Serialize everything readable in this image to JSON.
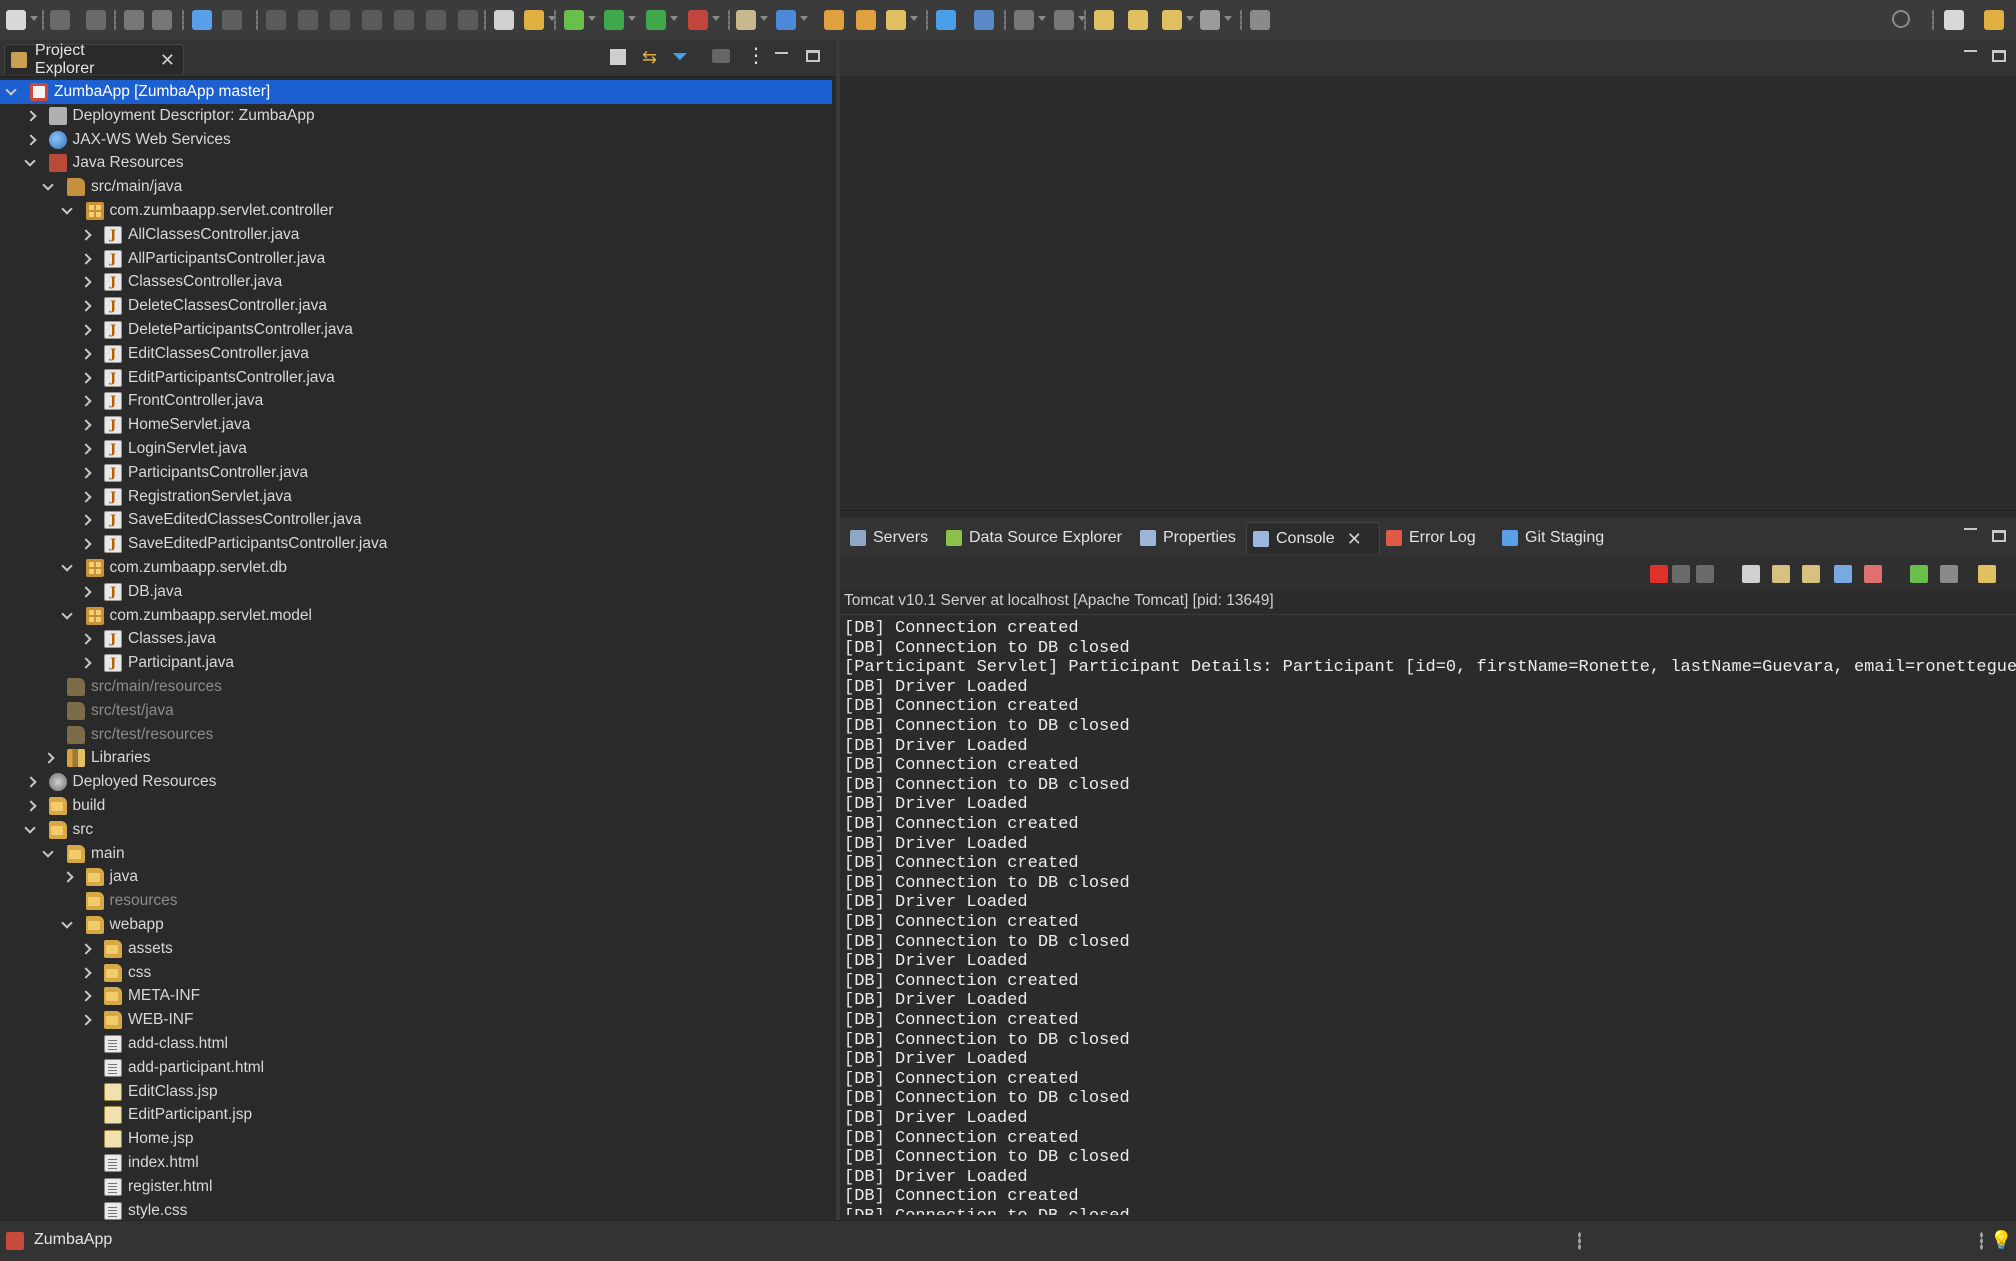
{
  "explorer": {
    "tab_label": "Project Explorer",
    "tree": [
      {
        "label": "ZumbaApp [ZumbaApp master]",
        "level": 0,
        "twisty": "open",
        "icon": "project-icon",
        "selected": true
      },
      {
        "label": "Deployment Descriptor: ZumbaApp",
        "level": 1,
        "twisty": "closed",
        "icon": "deployment-descriptor-icon"
      },
      {
        "label": "JAX-WS Web Services",
        "level": 1,
        "twisty": "closed",
        "icon": "web-services-icon"
      },
      {
        "label": "Java Resources",
        "level": 1,
        "twisty": "open",
        "icon": "java-resources-icon"
      },
      {
        "label": "src/main/java",
        "level": 2,
        "twisty": "open",
        "icon": "source-folder-icon"
      },
      {
        "label": "com.zumbaapp.servlet.controller",
        "level": 3,
        "twisty": "open",
        "icon": "package-icon"
      },
      {
        "label": "AllClassesController.java",
        "level": 4,
        "twisty": "closed",
        "icon": "java-file-icon"
      },
      {
        "label": "AllParticipantsController.java",
        "level": 4,
        "twisty": "closed",
        "icon": "java-file-icon"
      },
      {
        "label": "ClassesController.java",
        "level": 4,
        "twisty": "closed",
        "icon": "java-file-icon"
      },
      {
        "label": "DeleteClassesController.java",
        "level": 4,
        "twisty": "closed",
        "icon": "java-file-icon"
      },
      {
        "label": "DeleteParticipantsController.java",
        "level": 4,
        "twisty": "closed",
        "icon": "java-file-icon"
      },
      {
        "label": "EditClassesController.java",
        "level": 4,
        "twisty": "closed",
        "icon": "java-file-icon"
      },
      {
        "label": "EditParticipantsController.java",
        "level": 4,
        "twisty": "closed",
        "icon": "java-file-icon"
      },
      {
        "label": "FrontController.java",
        "level": 4,
        "twisty": "closed",
        "icon": "java-file-icon"
      },
      {
        "label": "HomeServlet.java",
        "level": 4,
        "twisty": "closed",
        "icon": "java-file-icon"
      },
      {
        "label": "LoginServlet.java",
        "level": 4,
        "twisty": "closed",
        "icon": "java-file-icon"
      },
      {
        "label": "ParticipantsController.java",
        "level": 4,
        "twisty": "closed",
        "icon": "java-file-icon"
      },
      {
        "label": "RegistrationServlet.java",
        "level": 4,
        "twisty": "closed",
        "icon": "java-file-icon"
      },
      {
        "label": "SaveEditedClassesController.java",
        "level": 4,
        "twisty": "closed",
        "icon": "java-file-icon"
      },
      {
        "label": "SaveEditedParticipantsController.java",
        "level": 4,
        "twisty": "closed",
        "icon": "java-file-icon"
      },
      {
        "label": "com.zumbaapp.servlet.db",
        "level": 3,
        "twisty": "open",
        "icon": "package-icon"
      },
      {
        "label": "DB.java",
        "level": 4,
        "twisty": "closed",
        "icon": "java-file-icon"
      },
      {
        "label": "com.zumbaapp.servlet.model",
        "level": 3,
        "twisty": "open",
        "icon": "package-icon"
      },
      {
        "label": "Classes.java",
        "level": 4,
        "twisty": "closed",
        "icon": "java-file-icon"
      },
      {
        "label": "Participant.java",
        "level": 4,
        "twisty": "closed",
        "icon": "java-file-icon"
      },
      {
        "label": "src/main/resources",
        "level": 2,
        "twisty": "none",
        "icon": "source-folder-icon",
        "dim": true
      },
      {
        "label": "src/test/java",
        "level": 2,
        "twisty": "none",
        "icon": "source-folder-icon",
        "dim": true
      },
      {
        "label": "src/test/resources",
        "level": 2,
        "twisty": "none",
        "icon": "source-folder-icon",
        "dim": true
      },
      {
        "label": "Libraries",
        "level": 2,
        "twisty": "closed",
        "icon": "libraries-icon"
      },
      {
        "label": "Deployed Resources",
        "level": 1,
        "twisty": "closed",
        "icon": "deployed-resources-icon"
      },
      {
        "label": "build",
        "level": 1,
        "twisty": "closed",
        "icon": "folder-icon"
      },
      {
        "label": "src",
        "level": 1,
        "twisty": "open",
        "icon": "folder-icon"
      },
      {
        "label": "main",
        "level": 2,
        "twisty": "open",
        "icon": "folder-icon"
      },
      {
        "label": "java",
        "level": 3,
        "twisty": "closed",
        "icon": "folder-icon"
      },
      {
        "label": "resources",
        "level": 3,
        "twisty": "none",
        "icon": "folder-icon",
        "dim": true
      },
      {
        "label": "webapp",
        "level": 3,
        "twisty": "open",
        "icon": "folder-icon"
      },
      {
        "label": "assets",
        "level": 4,
        "twisty": "closed",
        "icon": "folder-icon"
      },
      {
        "label": "css",
        "level": 4,
        "twisty": "closed",
        "icon": "folder-icon"
      },
      {
        "label": "META-INF",
        "level": 4,
        "twisty": "closed",
        "icon": "folder-icon"
      },
      {
        "label": "WEB-INF",
        "level": 4,
        "twisty": "closed",
        "icon": "folder-icon"
      },
      {
        "label": "add-class.html",
        "level": 4,
        "twisty": "none",
        "icon": "html-file-icon"
      },
      {
        "label": "add-participant.html",
        "level": 4,
        "twisty": "none",
        "icon": "html-file-icon"
      },
      {
        "label": "EditClass.jsp",
        "level": 4,
        "twisty": "none",
        "icon": "jsp-file-icon"
      },
      {
        "label": "EditParticipant.jsp",
        "level": 4,
        "twisty": "none",
        "icon": "jsp-file-icon"
      },
      {
        "label": "Home.jsp",
        "level": 4,
        "twisty": "none",
        "icon": "jsp-file-icon"
      },
      {
        "label": "index.html",
        "level": 4,
        "twisty": "none",
        "icon": "html-file-icon"
      },
      {
        "label": "register.html",
        "level": 4,
        "twisty": "none",
        "icon": "html-file-icon"
      },
      {
        "label": "style.css",
        "level": 4,
        "twisty": "none",
        "icon": "css-file-icon"
      }
    ]
  },
  "console": {
    "tabs": [
      {
        "label": "Servers",
        "icon": "servers-icon"
      },
      {
        "label": "Data Source Explorer",
        "icon": "data-source-icon"
      },
      {
        "label": "Properties",
        "icon": "properties-icon"
      },
      {
        "label": "Console",
        "icon": "console-icon",
        "active": true
      },
      {
        "label": "Error Log",
        "icon": "error-log-icon"
      },
      {
        "label": "Git Staging",
        "icon": "git-staging-icon"
      }
    ],
    "description": "Tomcat v10.1 Server at localhost [Apache Tomcat]  [pid: 13649]",
    "lines": [
      "[DB] Connection created",
      "[DB] Connection to DB closed",
      "[Participant Servlet] Participant Details: Participant [id=0, firstName=Ronette, lastName=Guevara, email=ronetteguevara",
      "[DB] Driver Loaded",
      "[DB] Connection created",
      "[DB] Connection to DB closed",
      "[DB] Driver Loaded",
      "[DB] Connection created",
      "[DB] Connection to DB closed",
      "[DB] Driver Loaded",
      "[DB] Connection created",
      "[DB] Driver Loaded",
      "[DB] Connection created",
      "[DB] Connection to DB closed",
      "[DB] Driver Loaded",
      "[DB] Connection created",
      "[DB] Connection to DB closed",
      "[DB] Driver Loaded",
      "[DB] Connection created",
      "[DB] Driver Loaded",
      "[DB] Connection created",
      "[DB] Connection to DB closed",
      "[DB] Driver Loaded",
      "[DB] Connection created",
      "[DB] Connection to DB closed",
      "[DB] Driver Loaded",
      "[DB] Connection created",
      "[DB] Connection to DB closed",
      "[DB] Driver Loaded",
      "[DB] Connection created",
      "[DB] Connection to DB closed"
    ]
  },
  "status": {
    "text": "ZumbaApp"
  },
  "colors": {
    "selection": "#1c5fd1",
    "background": "#2b2b2c"
  }
}
